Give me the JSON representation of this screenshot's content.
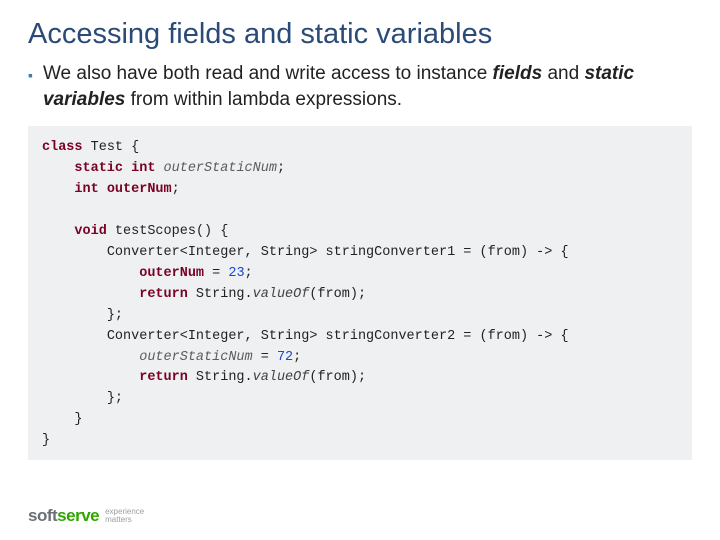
{
  "title": "Accessing fields and static variables",
  "bullet": {
    "pre": "We also have both read and write access to instance ",
    "em1": "fields",
    "mid": " and ",
    "em2": "static variables",
    "post": " from within lambda expressions."
  },
  "code": {
    "kw_class": "class",
    "cls": " Test {",
    "l2a": "static int",
    "l2b": "outerStaticNum",
    "l3a": "int",
    "l3b": "outerNum",
    "l4a": "void",
    "l4b": "testScopes",
    "l5": "Converter<Integer, String> stringConverter1 = (from) -> {",
    "l6a": "outerNum",
    "l6eq": " = ",
    "l6n": "23",
    "l7a": "return",
    "l7b": " String.",
    "l7c": "valueOf",
    "l7d": "(from);",
    "l8": "};",
    "l9": "Converter<Integer, String> stringConverter2 = (from) -> {",
    "l10a": "outerStaticNum",
    "l10eq": " = ",
    "l10n": "72",
    "l11a": "return",
    "l11b": " String.",
    "l11c": "valueOf",
    "l11d": "(from);",
    "l12": "};",
    "l13": "}",
    "l14": "}"
  },
  "brand": {
    "soft": "soft",
    "serve": "serve",
    "tag1": "experience",
    "tag2": "matters"
  }
}
